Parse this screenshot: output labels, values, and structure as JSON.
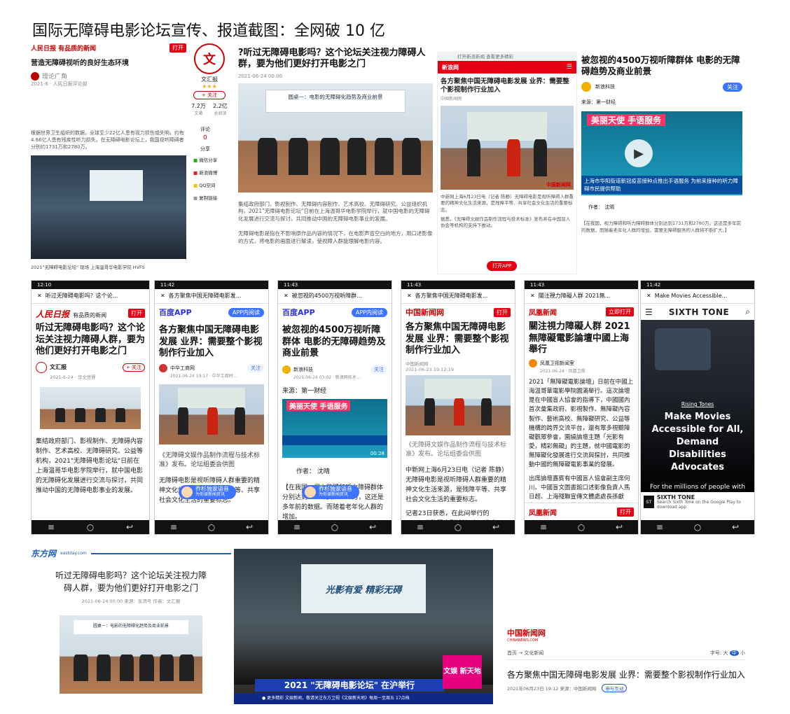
{
  "page_title": "国际无障碍电影论坛宣传、报道截图：全网破 10 亿",
  "shot1": {
    "brand": "人民日报 有品质的新闻",
    "brand_tag": "打开",
    "headline": "营造无障碍视听的良好生态环境",
    "author": "理论广角",
    "meta": "2021-6 · 人民日报评论部",
    "side_brand": "文汇报",
    "side_follow": "+ 关注",
    "side_stats": [
      {
        "value": "7.2万",
        "label": "文章"
      },
      {
        "value": "2.2亿",
        "label": "总阅读"
      }
    ],
    "share_label": "分享",
    "comment_label": "评论",
    "share_items": [
      "微信分享",
      "新浪微博",
      "QQ空间",
      "复制链接"
    ],
    "body": "根据世界卫生组织的数据，全球至少22亿人患有视力损伤或失明，约有4.66亿人患有残疾性听力损失。在无障碍电影论坛上，我国视听障碍者分别约1731万和2780万。",
    "photo_caption": "2021\"无障碍电影论坛\" 现场 上海温哥华电影学院 HVFS"
  },
  "shot2": {
    "headline": "?听过无障碍电影吗？这个论坛关注视力障碍人群，要为他们更好打开电影之门",
    "date": "2021-06-24 00:00",
    "banner": "圆桌一：电影的无障碍化趋势及商业前景",
    "body1": "集结政府部门、影视制作、无障碍内容制作、艺术高校、无障碍研究、公益组织机构，2021\"无障碍电影论坛\"日前在上海温哥华电影学院举行，就中国电影的无障碍化发展进行交流与探讨，共同推动中国的无障碍电影事业的发展。",
    "body2": "无障碍电影是指在不影响原作品内容的情况下，在电影声音空白的地方，用口述影像的方式，将电影的画面进行解读，使视障人群能理解电影内容。"
  },
  "shot3": {
    "topbar": "打开新浪新闻 查看更多精彩",
    "brand": "新浪网",
    "headline": "各方聚焦中国无障碍电影发展 业界：需要整个影视制作行业加入",
    "source": "中国新闻网",
    "photo_mark": "中国新闻网",
    "body": "中新网上海6月23日电（记者 陈静）无障碍电影是视听障碍人群重要的精神文化生活来源，是残障平等、共享社会文化生活的重要标志。",
    "body2": "据悉，《无障碍文娱作品制作流程与技术标准》发布并在中国盲人协会等机构的支持下推动。",
    "app_button": "打开APP"
  },
  "shot4": {
    "headline": "被忽视的4500万视听障群体 电影的无障碍趋势及商业前景",
    "author": "新浪科技",
    "follow": "关注",
    "source": "来源：第一财经",
    "video_banner": "美丽天使 手语服务",
    "video_sub": "上海市华阳街道新冠疫苗接种点推出手语服务 为前来接种的听力障碍市民提供帮助",
    "by": "作者：  沈晴",
    "body": "【在我国，视力障碍和听力障碍群体分别达到1731万和2780万。这还是多年前的数据，而随着老年化人群的增加，需要无障碍服务的人群将不断扩大。】"
  },
  "phones": [
    {
      "time": "12:10",
      "bar": "听过无障碍电影吗？这个论...",
      "logo": "人民日报",
      "logo_sub": "有品质的新闻",
      "logo_btn": "打开",
      "headline": "听过无障碍电影吗？这个论坛关注视力障碍人群，要为他们更好打开电影之门",
      "author": "文汇报",
      "author_meta": "2021-6-24 · 华文世界",
      "follow": "+ 关注",
      "body": "集结政府部门、影视制作、无障碍内容制作、艺术高校、无障碍研究、公益等机构，2021\"无障碍电影论坛\"日前在上海温哥华电影学院举行，就中国电影的无障碍化发展进行交流与探讨，共同推动中国的无障碍电影事业的发展。"
    },
    {
      "time": "11:42",
      "bar": "各方聚焦中国无障碍电影发...",
      "logo": "百度APP",
      "logo_btn": "APP内阅读",
      "headline": "各方聚焦中国无障碍电影发展 业界：需要整个影视制作行业加入",
      "author": "中华工商网",
      "author_meta": "2021-06-24 19:17 · 中华工商时...",
      "follow": "关注",
      "caption": "《无障碍文娱作品制作流程与技术标准》发布。论坛组委会供图",
      "body": "无障碍电影是视听障碍人群重要的精神文化生活来源，是残障平等、共享社会文化生活的重要标志。",
      "voice": "乔杉独家语音",
      "voice_sub": "为你读新闻资讯"
    },
    {
      "time": "11:43",
      "bar": "被忽视的4500万视听障群...",
      "logo": "百度APP",
      "logo_btn": "APP内阅读",
      "headline": "被忽视的4500万视听障群体 电影的无障碍趋势及商业前景",
      "author": "新浪科技",
      "author_meta": "2021-06-24 03:02 · 新浪网技术...",
      "follow": "关注",
      "source": "来源：第一财经",
      "video_banner": "美丽天使 手语服务",
      "video_time": "00:28",
      "by": "作者：  沈晴",
      "body": "【在我国，视力障碍和听力障碍群体分别达到1731万和2780万，这还是多年前的数据。而随着老年化人群的增加。",
      "voice": "乔杉独家语音",
      "voice_sub": "为你读新闻资讯"
    },
    {
      "time": "11:43",
      "bar": "各方聚焦中国无障碍电影发...",
      "logo": "中国新闻网",
      "logo_btn": "打开",
      "headline": "各方聚焦中国无障碍电影发展 业界：需要整个影视制作行业加入",
      "author": "中国新闻网",
      "author_meta": "2021-06-23 19:12:19",
      "caption": "《无障碍文娱作品制作流程与技术标准》发布。论坛组委会供图",
      "body": "中新网上海6月23日电（记者 陈静）无障碍电影是视听障碍人群重要的精神文化生活来源，是残障平等、共享社会文化生活的重要标志。",
      "body2": "记者23日获悉，在此间举行的2021\"无障碍电影论坛\"上，政府、"
    },
    {
      "time": "11:43",
      "bar": "關注視力障礙人群 2021無...",
      "logo": "凤凰新闻",
      "logo_btn": "立即打开",
      "headline": "關注視力障礙人群 2021無障礙電影論壇中國上海舉行",
      "author": "凤凰卫视新闻室",
      "author_meta": "2021-06-24 · 凤凰卫视",
      "body": "2021「無障礙電影論壇」日前在中國上海溫哥華電影學院圓滿舉行。這次論壇是在中國盲人協會的指導下，中國國內首次彙集政府、影視製作、無障礙內容製作、藝術高校、無障礙研究、公益等機構的跨界交流平台，還有眾多視聽障礙觀眾參會，圍繞論壇主題「光影有愛，精彩無礙」的主題，就中國電影的無障礙化發展進行交流與探討，共同推動中國的無障礙電影事業的發展。",
      "body2": "出席論壇嘉賓有中國盲人協會副主席何川、中國盲文圖書館口述影像負責人馬日超、上海殘聯宣傳文體處處長孫獻忠、溫唐光影影業導演趙漢唐、上海電影評論學會秘書長黃一慶、上海溫哥華電影學院執行院長吾為",
      "footer_logo": "凤凰新闻",
      "footer_btn": "打开"
    },
    {
      "time": "11:42",
      "bar": "Make Movies Accessible...",
      "logo": "SIXTH TONE",
      "tag": "Rising Tones",
      "headline": "Make Movies Accessible for All, Demand Disabilities Advocates",
      "sub": "For the millions of people with",
      "footer_title": "SIXTH TONE",
      "footer_text": "Search Sixth Tone on the Google Play to download app"
    }
  ],
  "bottom1": {
    "brand": "东方网",
    "brand_sub": "eastday.com",
    "headline": "听过无障碍电影吗？这个论坛关注视力障碍人群，要为他们更好打开电影之门",
    "meta": "2021-06-24 00:00  来源：澎湃号  作者：文汇报",
    "banner": "圆桌一：电影的无障碍化趋势及商业前景"
  },
  "bottom2": {
    "stage_text": "光影有爱 精彩无碍",
    "banner": "2021 \"无障碍电影论坛\" 在沪举行",
    "ticker": "● 更多精彩 文娱新闻，敬请关注东方卫视《文娱新天地》每周一至周五 17点档",
    "corner": "文娱 新天地"
  },
  "bottom3": {
    "brand": "中国新闻网",
    "brand_sub": "CHINANEWS.COM",
    "crumb": "首页 → 文化新闻",
    "font_label": "字号:",
    "font_sizes": [
      "大",
      "中",
      "小"
    ],
    "headline": "各方聚焦中国无障碍电影发展 业界：需要整个影视制作行业加入",
    "meta": "2021年06月23日 19:12  来源：中国新闻网",
    "share": "参与互动"
  }
}
